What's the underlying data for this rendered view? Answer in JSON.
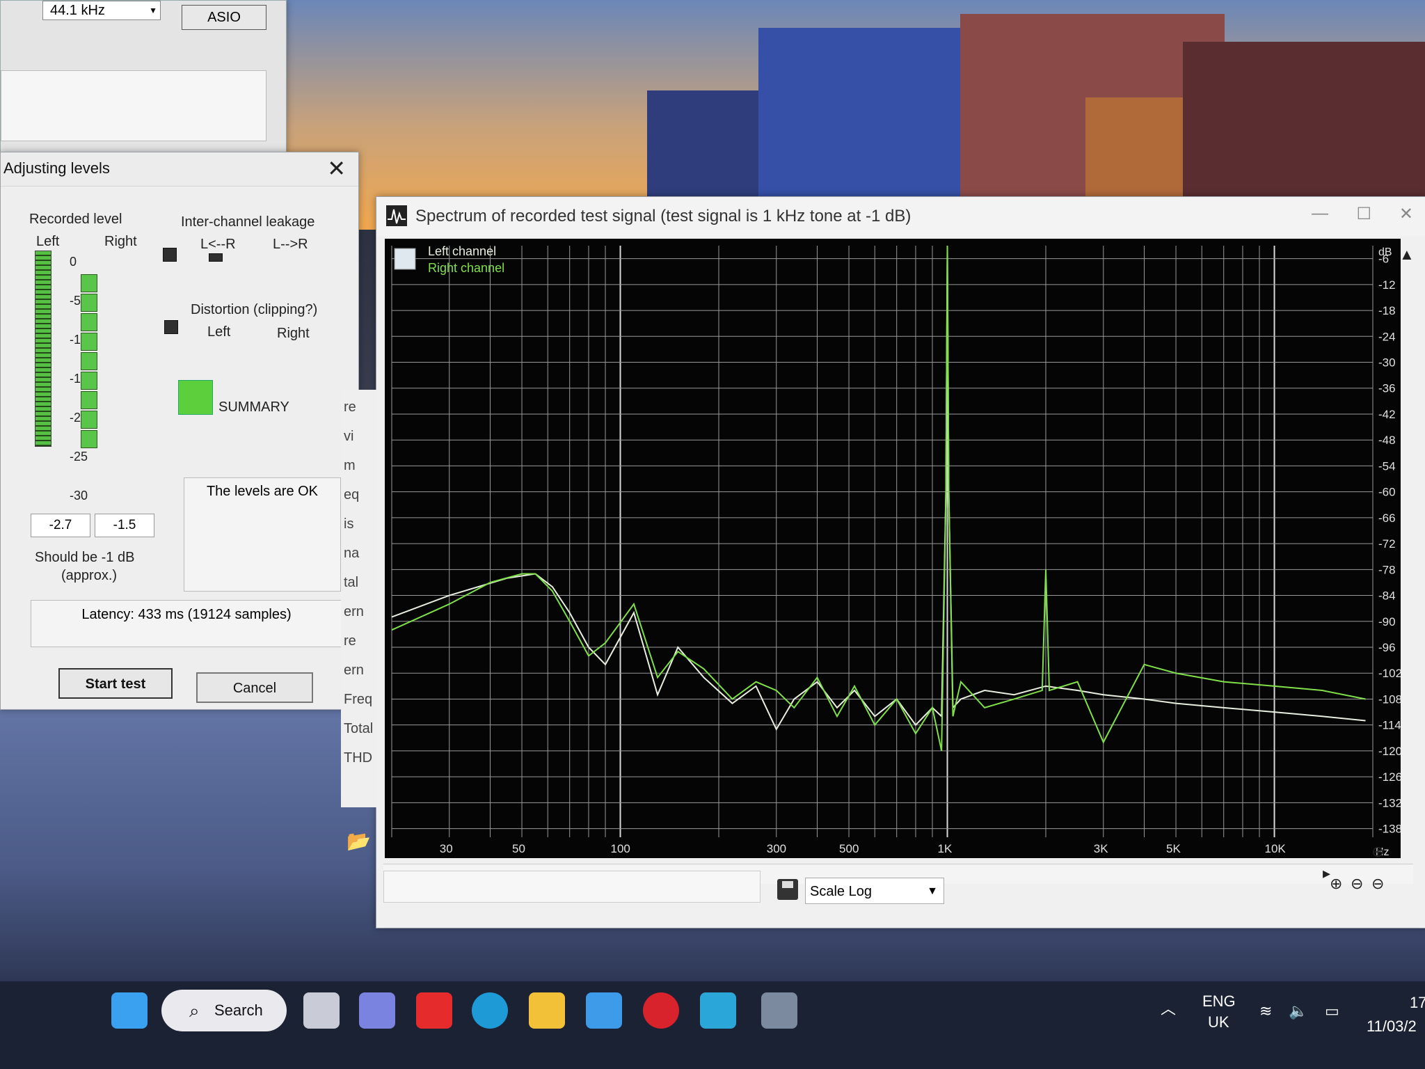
{
  "background": {
    "sky_color": "#c8a27b",
    "building_colors": [
      "#3550a6",
      "#8a4a48",
      "#5a2e30",
      "#2f3d7d",
      "#b06a3a"
    ]
  },
  "back_window": {
    "sample_rate": "44.1 kHz",
    "driver_button": "ASIO"
  },
  "adjusting_levels": {
    "title": "Adjusting levels",
    "recorded_level_label": "Recorded level",
    "left_label": "Left",
    "right_label": "Right",
    "scale_ticks": [
      "0",
      "-5",
      "-10",
      "-15",
      "-20",
      "-25",
      "-30"
    ],
    "left_value": "-2.7",
    "right_value": "-1.5",
    "should_be_text": "Should be  -1 dB",
    "approx_text": "(approx.)",
    "leakage_label": "Inter-channel leakage",
    "leakage_lr": "L<--R",
    "leakage_rl": "L-->R",
    "distortion_label": "Distortion (clipping?)",
    "distortion_left": "Left",
    "distortion_right": "Right",
    "summary_label": "SUMMARY",
    "summary_color": "#5bd03c",
    "status_text": "The levels are OK",
    "latency_text": "Latency: 433 ms (19124 samples)",
    "start_button": "Start test",
    "cancel_button": "Cancel"
  },
  "spectrum_window": {
    "title": "Spectrum of recorded test signal (test signal is 1 kHz tone at -1 dB)",
    "legend_left": "Left channel",
    "legend_right": "Right channel",
    "left_color": "#e8efe0",
    "right_color": "#7fe04a",
    "side_labels": [
      "re",
      "vi",
      "m",
      "eq",
      "is",
      "na",
      "tal",
      "ern",
      "re",
      "ern",
      "Freq",
      "Total",
      "THD"
    ],
    "scale_label": "Scale",
    "scale_value": "Log",
    "chart_data": {
      "type": "line",
      "title": "",
      "xlabel": "Hz",
      "ylabel": "dB",
      "x_scale": "log",
      "xlim": [
        20,
        20000
      ],
      "ylim": [
        -140,
        -3
      ],
      "x_ticks": [
        "30",
        "50",
        "100",
        "300",
        "500",
        "1K",
        "3K",
        "5K",
        "10K"
      ],
      "x_tick_values": [
        30,
        50,
        100,
        300,
        500,
        1000,
        3000,
        5000,
        10000
      ],
      "y_ticks": [
        "-6",
        "-12",
        "-18",
        "-24",
        "-30",
        "-36",
        "-42",
        "-48",
        "-54",
        "-60",
        "-66",
        "-72",
        "-78",
        "-84",
        "-90",
        "-96",
        "-102",
        "-108",
        "-114",
        "-120",
        "-126",
        "-132",
        "-138"
      ],
      "y_tick_values": [
        -6,
        -12,
        -18,
        -24,
        -30,
        -36,
        -42,
        -48,
        -54,
        -60,
        -66,
        -72,
        -78,
        -84,
        -90,
        -96,
        -102,
        -108,
        -114,
        -120,
        -126,
        -132,
        -138
      ],
      "grid": true,
      "legend": "top-left",
      "series": [
        {
          "name": "Left channel",
          "x": [
            20,
            30,
            45,
            55,
            62,
            70,
            80,
            90,
            110,
            130,
            150,
            180,
            220,
            260,
            300,
            340,
            400,
            460,
            520,
            600,
            700,
            800,
            900,
            960,
            990,
            1000,
            1010,
            1040,
            1100,
            1300,
            1600,
            2000,
            2500,
            3000,
            4000,
            5000,
            7000,
            10000,
            14000,
            19000
          ],
          "y": [
            -89,
            -84,
            -80,
            -79,
            -82,
            -88,
            -96,
            -100,
            -88,
            -107,
            -96,
            -103,
            -109,
            -105,
            -115,
            -108,
            -104,
            -110,
            -106,
            -112,
            -108,
            -114,
            -110,
            -112,
            -60,
            -4,
            -60,
            -110,
            -108,
            -106,
            -107,
            -105,
            -106,
            -107,
            -108,
            -109,
            -110,
            -111,
            -112,
            -113
          ]
        },
        {
          "name": "Right channel",
          "x": [
            20,
            30,
            40,
            50,
            55,
            62,
            70,
            80,
            90,
            110,
            130,
            150,
            180,
            220,
            260,
            300,
            340,
            400,
            460,
            520,
            600,
            700,
            800,
            900,
            960,
            990,
            1000,
            1010,
            1040,
            1100,
            1300,
            1600,
            1950,
            2000,
            2050,
            2500,
            3000,
            4000,
            5000,
            7000,
            10000,
            14000,
            19000
          ],
          "y": [
            -92,
            -86,
            -81,
            -79,
            -79,
            -83,
            -90,
            -98,
            -95,
            -86,
            -103,
            -97,
            -101,
            -108,
            -104,
            -106,
            -110,
            -103,
            -112,
            -105,
            -114,
            -108,
            -116,
            -110,
            -120,
            -60,
            -3,
            -60,
            -112,
            -104,
            -110,
            -108,
            -106,
            -78,
            -106,
            -104,
            -118,
            -100,
            -102,
            -104,
            -105,
            -106,
            -108
          ]
        }
      ]
    }
  },
  "taskbar": {
    "search_label": "Search",
    "lang": "ENG",
    "region": "UK",
    "date": "11/03/2",
    "time": "17"
  }
}
